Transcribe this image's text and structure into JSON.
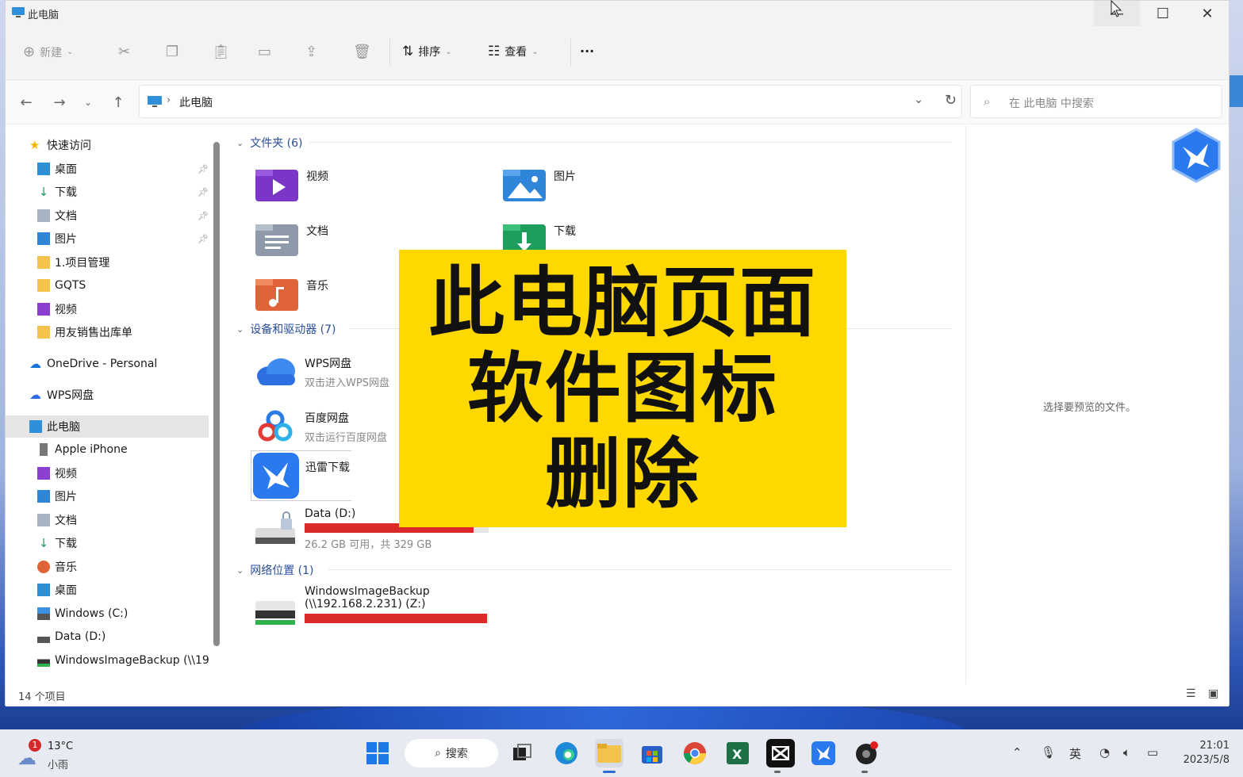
{
  "window": {
    "title": "此电脑",
    "toolbar": {
      "new_label": "新建",
      "sort_label": "排序",
      "view_label": "查看",
      "more_label": "···"
    },
    "address": {
      "crumb": "此电脑",
      "search_placeholder": "在 此电脑 中搜索"
    }
  },
  "sidebar": {
    "quick_access": "快速访问",
    "quick_items": [
      "桌面",
      "下载",
      "文档",
      "图片",
      "1.项目管理",
      "GQTS",
      "视频",
      "用友销售出库单"
    ],
    "onedrive": "OneDrive - Personal",
    "wps": "WPS网盘",
    "this_pc": "此电脑",
    "pc_items": [
      "Apple iPhone",
      "视频",
      "图片",
      "文档",
      "下载",
      "音乐",
      "桌面",
      "Windows (C:)",
      "Data (D:)",
      "WindowsImageBackup (\\\\19"
    ]
  },
  "content": {
    "folders_header": "文件夹 (6)",
    "folders": [
      "视频",
      "图片",
      "文档",
      "下载",
      "音乐"
    ],
    "devices_header": "设备和驱动器 (7)",
    "devices": [
      {
        "name": "WPS网盘",
        "sub": "双击进入WPS网盘"
      },
      {
        "name": "百度网盘",
        "sub": "双击运行百度网盘"
      },
      {
        "name": "迅雷下载",
        "sub": ""
      }
    ],
    "drive_d": {
      "name": "Data (D:)",
      "sub": "26.2 GB 可用，共 329 GB",
      "used_fraction": 0.92
    },
    "network_header": "网络位置 (1)",
    "network_drive": {
      "name1": "WindowsImageBackup",
      "name2": "(\\\\192.168.2.231) (Z:)",
      "used_fraction": 0.99
    },
    "preview_text": "选择要预览的文件。"
  },
  "banner": {
    "line1": "此电脑页面",
    "line2": "软件图标",
    "line3": "删除"
  },
  "status": {
    "count": "14 个项目"
  },
  "taskbar": {
    "temp": "13°C",
    "condition": "小雨",
    "weather_badge": "1",
    "search_label": "搜索",
    "ime": "英",
    "time": "21:01",
    "date": "2023/5/8"
  },
  "colors": {
    "banner_bg": "#ffd800",
    "drive_fill": "#da2a2a",
    "group_header": "#2a4d9b"
  }
}
